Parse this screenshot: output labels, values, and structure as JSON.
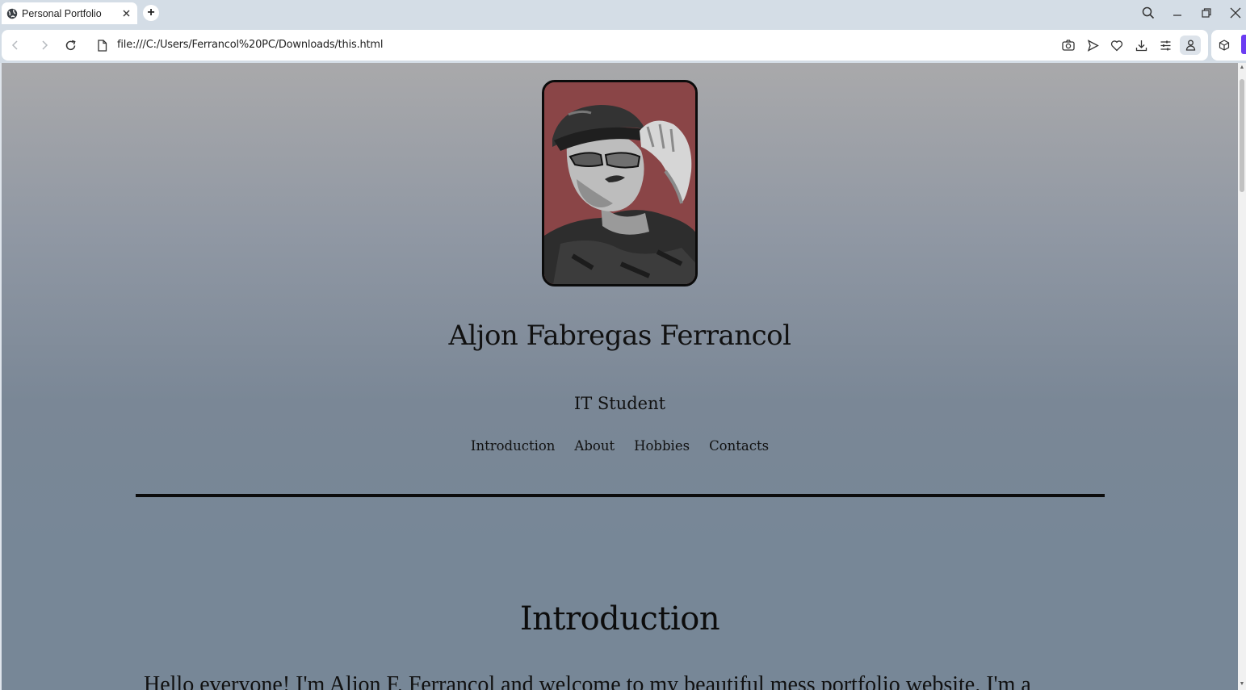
{
  "browser": {
    "tab_title": "Personal Portfolio",
    "new_tab_label": "+",
    "url": "file:///C:/Users/Ferrancol%20PC/Downloads/this.html"
  },
  "page": {
    "name": "Aljon Fabregas Ferrancol",
    "role": "IT Student",
    "nav": [
      "Introduction",
      "About",
      "Hobbies",
      "Contacts"
    ],
    "section_heading": "Introduction",
    "intro_text": "Hello everyone! I'm Aljon F. Ferrancol and welcome to my beautiful mess portfolio website. I'm a"
  },
  "icons": {
    "tab_favicon": "globe-icon",
    "tab_close": "close-icon",
    "back": "arrow-left-icon",
    "forward": "arrow-right-icon",
    "reload": "reload-icon",
    "page_info": "document-icon",
    "zoom": "search-icon",
    "minimize": "minimize-icon",
    "restore": "restore-icon",
    "close_window": "close-icon",
    "snapshot": "camera-icon",
    "send": "send-icon",
    "favorite": "heart-icon",
    "download": "download-icon",
    "easy_setup": "sliders-icon",
    "profile": "profile-icon",
    "extensions": "cube-icon"
  },
  "colors": {
    "chrome": "#d4dde6",
    "page_top": "#a9a9ab",
    "page_bottom": "#778797",
    "photo_bg": "#8a4547"
  }
}
